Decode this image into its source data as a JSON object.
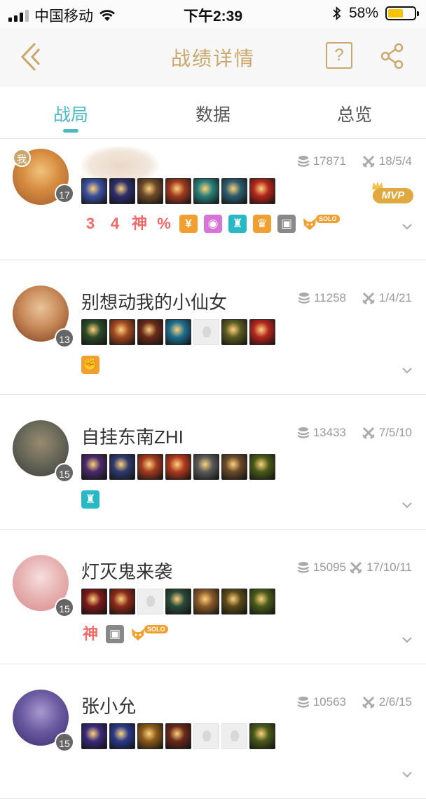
{
  "status_bar": {
    "carrier": "中国移动",
    "time": "下午2:39",
    "battery": "58%",
    "battery_level": 0.58
  },
  "nav": {
    "title": "战绩详情",
    "help": "?"
  },
  "tabs": [
    {
      "label": "战局",
      "active": true
    },
    {
      "label": "数据",
      "active": false
    },
    {
      "label": "总览",
      "active": false
    }
  ],
  "players": [
    {
      "name": "",
      "name_hidden": true,
      "me_badge": "我",
      "level": "17",
      "gold": "17871",
      "kda": "18/5/4",
      "mvp": "MVP",
      "avatar_colors": [
        "#9b5a32",
        "#d58a3e",
        "#f1c27d"
      ],
      "items": [
        "#3b4fa0",
        "#2d2e6b",
        "#6d4a2a",
        "#a03a1f",
        "#2a7f7a",
        "#2f5c6e",
        "#b3261e"
      ],
      "badges": [
        {
          "kind": "text",
          "text": "3",
          "color": "#f06a6a"
        },
        {
          "kind": "text",
          "text": "4",
          "color": "#f06a6a"
        },
        {
          "kind": "text",
          "text": "神",
          "color": "#f06a6a"
        },
        {
          "kind": "text",
          "text": "%",
          "color": "#f06a6a"
        },
        {
          "kind": "box",
          "text": "¥",
          "color": "#f0a030"
        },
        {
          "kind": "box",
          "text": "◉",
          "color": "#d873d8"
        },
        {
          "kind": "box",
          "text": "♜",
          "color": "#2ab8c4"
        },
        {
          "kind": "box",
          "text": "♛",
          "color": "#f0a030"
        },
        {
          "kind": "box",
          "text": "▣",
          "color": "#888888"
        },
        {
          "kind": "solo",
          "text": "SOLO",
          "color": "#f0a030"
        }
      ]
    },
    {
      "name": "别想动我的小仙女",
      "level": "13",
      "gold": "11258",
      "kda": "1/4/21",
      "avatar_colors": [
        "#7a3a1e",
        "#c98a5a",
        "#e8c49a"
      ],
      "items": [
        "#2e4a2a",
        "#a04a20",
        "#6a2a1a",
        "#1f6f8f",
        "empty",
        "#5b5a22",
        "#b3261e"
      ],
      "badges": [
        {
          "kind": "box",
          "text": "✊",
          "color": "#f0a030"
        }
      ]
    },
    {
      "name": "自挂东南ZHI",
      "level": "15",
      "gold": "13433",
      "kda": "7/5/10",
      "avatar_colors": [
        "#3a3a3a",
        "#6a6a5a",
        "#9a8a70"
      ],
      "items": [
        "#4a2a6a",
        "#2f3a6e",
        "#a23a20",
        "#b03a1f",
        "#5a5a5a",
        "#6a4a2a",
        "#4a5a1a"
      ],
      "badges": [
        {
          "kind": "box",
          "text": "♜",
          "color": "#2ab8c4"
        }
      ]
    },
    {
      "name": "灯灭鬼来袭",
      "level": "15",
      "gold": "15095",
      "kda": "17/10/11",
      "avatar_colors": [
        "#d88a8a",
        "#e8b4b4",
        "#f6dede"
      ],
      "items": [
        "#7a1a1a",
        "#8a2a1a",
        "empty",
        "#2a4a3a",
        "#8a5a2a",
        "#5a4a1a",
        "#4a5a1a"
      ],
      "badges": [
        {
          "kind": "text",
          "text": "神",
          "color": "#f06a6a"
        },
        {
          "kind": "box",
          "text": "▣",
          "color": "#888888"
        },
        {
          "kind": "solo",
          "text": "SOLO",
          "color": "#f0a030"
        }
      ]
    },
    {
      "name": "张小允",
      "level": "15",
      "gold": "10563",
      "kda": "2/6/15",
      "avatar_colors": [
        "#3a2a6a",
        "#6a5aa0",
        "#a89ad0"
      ],
      "items": [
        "#3a2a7a",
        "#2a3a8a",
        "#8a5a1a",
        "#6a2a1a",
        "empty",
        "empty",
        "#4a5a1a"
      ],
      "badges": []
    }
  ]
}
